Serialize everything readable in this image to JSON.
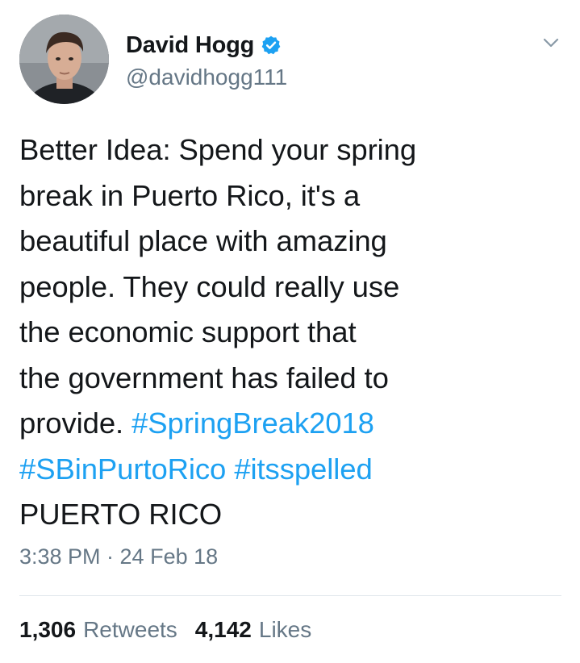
{
  "author": {
    "display_name": "David Hogg",
    "handle": "@davidhogg111",
    "verified": true,
    "verified_color": "#1da1f2"
  },
  "tweet": {
    "lines": [
      [
        {
          "text": "Better Idea: Spend your spring",
          "type": "text"
        }
      ],
      [
        {
          "text": "break in Puerto Rico, it's a",
          "type": "text"
        }
      ],
      [
        {
          "text": "beautiful place with amazing",
          "type": "text"
        }
      ],
      [
        {
          "text": "people. They could really use",
          "type": "text"
        }
      ],
      [
        {
          "text": "the economic support that",
          "type": "text"
        }
      ],
      [
        {
          "text": "the government has failed to",
          "type": "text"
        }
      ],
      [
        {
          "text": "provide. ",
          "type": "text"
        },
        {
          "text": "#SpringBreak2018",
          "type": "hashtag"
        }
      ],
      [
        {
          "text": "#SBinPurtoRico",
          "type": "hashtag"
        },
        {
          "text": " ",
          "type": "text"
        },
        {
          "text": "#itsspelled",
          "type": "hashtag"
        }
      ],
      [
        {
          "text": "PUERTO RICO",
          "type": "text"
        }
      ]
    ],
    "timestamp": "3:38 PM · 24 Feb 18"
  },
  "stats": {
    "retweets_count": "1,306",
    "retweets_label": "Retweets",
    "likes_count": "4,142",
    "likes_label": "Likes"
  },
  "colors": {
    "hashtag": "#1da1f2",
    "secondary_text": "#657786",
    "primary_text": "#14171a",
    "divider": "#e1e8ed"
  },
  "icons": {
    "verified": "verified-badge-icon",
    "menu": "chevron-down-icon"
  }
}
